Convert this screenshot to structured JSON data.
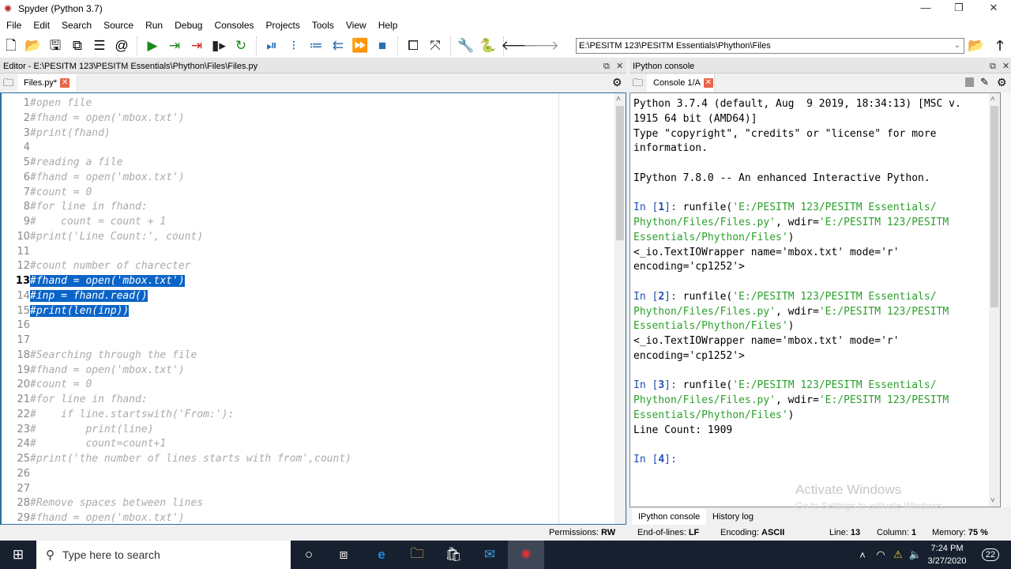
{
  "window": {
    "title": "Spyder (Python 3.7)",
    "controls": {
      "minimize": "—",
      "restore": "❐",
      "close": "✕"
    }
  },
  "menu": [
    "File",
    "Edit",
    "Search",
    "Source",
    "Run",
    "Debug",
    "Consoles",
    "Projects",
    "Tools",
    "View",
    "Help"
  ],
  "toolbar": {
    "icons": [
      {
        "name": "new-file-icon",
        "glyph": "🗋",
        "color": "#000"
      },
      {
        "name": "open-folder-icon",
        "glyph": "📂",
        "color": "#000"
      },
      {
        "name": "save-icon",
        "glyph": "🖫",
        "color": "#000"
      },
      {
        "name": "save-all-icon",
        "glyph": "⧉",
        "color": "#000"
      },
      {
        "name": "list-icon",
        "glyph": "☰",
        "color": "#000"
      },
      {
        "name": "at-icon",
        "glyph": "@",
        "color": "#000"
      },
      {
        "name": "run-icon",
        "glyph": "▶",
        "color": "#1a8a1a"
      },
      {
        "name": "run-cell-icon",
        "glyph": "⇥",
        "color": "#1a8a1a"
      },
      {
        "name": "run-cell-advance-icon",
        "glyph": "⇥",
        "color": "#d02020"
      },
      {
        "name": "run-selection-icon",
        "glyph": "▮▸",
        "color": "#222"
      },
      {
        "name": "rerun-icon",
        "glyph": "↻",
        "color": "#1a8a1a"
      },
      {
        "name": "debug-icon",
        "glyph": "⏯",
        "color": "#2a6fb0"
      },
      {
        "name": "step-icon",
        "glyph": "⁝",
        "color": "#2a6fb0"
      },
      {
        "name": "step-into-icon",
        "glyph": "≔",
        "color": "#2a6fb0"
      },
      {
        "name": "step-return-icon",
        "glyph": "⇇",
        "color": "#2a6fb0"
      },
      {
        "name": "continue-icon",
        "glyph": "⏩",
        "color": "#2a6fb0"
      },
      {
        "name": "stop-icon",
        "glyph": "■",
        "color": "#2a6fb0"
      },
      {
        "name": "maximize-pane-icon",
        "glyph": "⧠",
        "color": "#222"
      },
      {
        "name": "fullscreen-icon",
        "glyph": "⤧",
        "color": "#222"
      },
      {
        "name": "preferences-wrench-icon",
        "glyph": "🔧",
        "color": "#222"
      },
      {
        "name": "python-path-icon",
        "glyph": "🐍",
        "color": "#3572a5"
      },
      {
        "name": "back-arrow-icon",
        "glyph": "🡐",
        "color": "#222"
      },
      {
        "name": "forward-arrow-icon",
        "glyph": "🡒",
        "color": "#999"
      }
    ],
    "working_dir": "E:\\PESITM 123\\PESITM Essentials\\Phython\\Files"
  },
  "editor": {
    "pane_title": "Editor - E:\\PESITM 123\\PESITM Essentials\\Phython\\Files\\Files.py",
    "tab_label": "Files.py*",
    "current_line": 13,
    "lines": [
      {
        "n": "1",
        "text": "#open file",
        "sel": false
      },
      {
        "n": "2",
        "text": "#fhand = open('mbox.txt')",
        "sel": false
      },
      {
        "n": "3",
        "text": "#print(fhand)",
        "sel": false
      },
      {
        "n": "4",
        "text": "",
        "sel": false
      },
      {
        "n": "5",
        "text": "#reading a file",
        "sel": false
      },
      {
        "n": "6",
        "text": "#fhand = open('mbox.txt')",
        "sel": false
      },
      {
        "n": "7",
        "text": "#count = 0",
        "sel": false
      },
      {
        "n": "8",
        "text": "#for line in fhand:",
        "sel": false
      },
      {
        "n": "9",
        "text": "#    count = count + 1",
        "sel": false
      },
      {
        "n": "10",
        "text": "#print('Line Count:', count)",
        "sel": false
      },
      {
        "n": "11",
        "text": "",
        "sel": false
      },
      {
        "n": "12",
        "text": "#count number of charecter",
        "sel": false
      },
      {
        "n": "13",
        "text": "#fhand = open('mbox.txt')",
        "sel": true
      },
      {
        "n": "14",
        "text": "#inp = fhand.read()",
        "sel": true
      },
      {
        "n": "15",
        "text": "#print(len(inp))",
        "sel": true
      },
      {
        "n": "16",
        "text": "",
        "sel": false
      },
      {
        "n": "17",
        "text": "",
        "sel": false
      },
      {
        "n": "18",
        "text": "#Searching through the file",
        "sel": false
      },
      {
        "n": "19",
        "text": "#fhand = open('mbox.txt')",
        "sel": false
      },
      {
        "n": "20",
        "text": "#count = 0",
        "sel": false
      },
      {
        "n": "21",
        "text": "#for line in fhand:",
        "sel": false
      },
      {
        "n": "22",
        "text": "#    if line.startswith('From:'):",
        "sel": false
      },
      {
        "n": "23",
        "text": "#        print(line)",
        "sel": false
      },
      {
        "n": "24",
        "text": "#        count=count+1",
        "sel": false
      },
      {
        "n": "25",
        "text": "#print('the number of lines starts with from',count)",
        "sel": false
      },
      {
        "n": "26",
        "text": "",
        "sel": false
      },
      {
        "n": "27",
        "text": "",
        "sel": false
      },
      {
        "n": "28",
        "text": "#Remove spaces between lines",
        "sel": false
      },
      {
        "n": "29",
        "text": "#fhand = open('mbox.txt')",
        "sel": false
      }
    ]
  },
  "console": {
    "pane_title": "IPython console",
    "tab_label": "Console 1/A",
    "lines": [
      {
        "parts": [
          {
            "t": "Python 3.7.4 (default, Aug  9 2019, 18:34:13) [MSC v.",
            "c": ""
          }
        ]
      },
      {
        "parts": [
          {
            "t": "1915 64 bit (AMD64)]",
            "c": ""
          }
        ]
      },
      {
        "parts": [
          {
            "t": "Type \"copyright\", \"credits\" or \"license\" for more",
            "c": ""
          }
        ]
      },
      {
        "parts": [
          {
            "t": "information.",
            "c": ""
          }
        ]
      },
      {
        "parts": []
      },
      {
        "parts": [
          {
            "t": "IPython 7.8.0 -- An enhanced Interactive Python.",
            "c": ""
          }
        ]
      },
      {
        "parts": []
      },
      {
        "parts": [
          {
            "t": "In [",
            "c": "prompt"
          },
          {
            "t": "1",
            "c": "blue"
          },
          {
            "t": "]: ",
            "c": "prompt"
          },
          {
            "t": "runfile(",
            "c": ""
          },
          {
            "t": "'E:/PESITM 123/PESITM Essentials/",
            "c": "grn"
          }
        ]
      },
      {
        "parts": [
          {
            "t": "Phython/Files/Files.py'",
            "c": "grn"
          },
          {
            "t": ", wdir=",
            "c": ""
          },
          {
            "t": "'E:/PESITM 123/PESITM",
            "c": "grn"
          }
        ]
      },
      {
        "parts": [
          {
            "t": "Essentials/Phython/Files'",
            "c": "grn"
          },
          {
            "t": ")",
            "c": ""
          }
        ]
      },
      {
        "parts": [
          {
            "t": "<_io.TextIOWrapper name='mbox.txt' mode='r'",
            "c": ""
          }
        ]
      },
      {
        "parts": [
          {
            "t": "encoding='cp1252'>",
            "c": ""
          }
        ]
      },
      {
        "parts": []
      },
      {
        "parts": [
          {
            "t": "In [",
            "c": "prompt"
          },
          {
            "t": "2",
            "c": "blue"
          },
          {
            "t": "]: ",
            "c": "prompt"
          },
          {
            "t": "runfile(",
            "c": ""
          },
          {
            "t": "'E:/PESITM 123/PESITM Essentials/",
            "c": "grn"
          }
        ]
      },
      {
        "parts": [
          {
            "t": "Phython/Files/Files.py'",
            "c": "grn"
          },
          {
            "t": ", wdir=",
            "c": ""
          },
          {
            "t": "'E:/PESITM 123/PESITM",
            "c": "grn"
          }
        ]
      },
      {
        "parts": [
          {
            "t": "Essentials/Phython/Files'",
            "c": "grn"
          },
          {
            "t": ")",
            "c": ""
          }
        ]
      },
      {
        "parts": [
          {
            "t": "<_io.TextIOWrapper name='mbox.txt' mode='r'",
            "c": ""
          }
        ]
      },
      {
        "parts": [
          {
            "t": "encoding='cp1252'>",
            "c": ""
          }
        ]
      },
      {
        "parts": []
      },
      {
        "parts": [
          {
            "t": "In [",
            "c": "prompt"
          },
          {
            "t": "3",
            "c": "blue"
          },
          {
            "t": "]: ",
            "c": "prompt"
          },
          {
            "t": "runfile(",
            "c": ""
          },
          {
            "t": "'E:/PESITM 123/PESITM Essentials/",
            "c": "grn"
          }
        ]
      },
      {
        "parts": [
          {
            "t": "Phython/Files/Files.py'",
            "c": "grn"
          },
          {
            "t": ", wdir=",
            "c": ""
          },
          {
            "t": "'E:/PESITM 123/PESITM",
            "c": "grn"
          }
        ]
      },
      {
        "parts": [
          {
            "t": "Essentials/Phython/Files'",
            "c": "grn"
          },
          {
            "t": ")",
            "c": ""
          }
        ]
      },
      {
        "parts": [
          {
            "t": "Line Count: 1909",
            "c": ""
          }
        ]
      },
      {
        "parts": []
      },
      {
        "parts": [
          {
            "t": "In [",
            "c": "prompt"
          },
          {
            "t": "4",
            "c": "blue"
          },
          {
            "t": "]: ",
            "c": "prompt"
          }
        ]
      }
    ],
    "bottom_tabs": [
      "IPython console",
      "History log"
    ]
  },
  "watermark": {
    "line1": "Activate Windows",
    "line2": "Go to Settings to activate Windows."
  },
  "statusbar": {
    "permissions_label": "Permissions:",
    "permissions": "RW",
    "eol_label": "End-of-lines:",
    "eol": "LF",
    "encoding_label": "Encoding:",
    "encoding": "ASCII",
    "line_label": "Line:",
    "line": "13",
    "column_label": "Column:",
    "column": "1",
    "memory_label": "Memory:",
    "memory": "75 %"
  },
  "taskbar": {
    "search_placeholder": "Type here to search",
    "time": "7:24 PM",
    "date": "3/27/2020",
    "notifications": "22"
  }
}
